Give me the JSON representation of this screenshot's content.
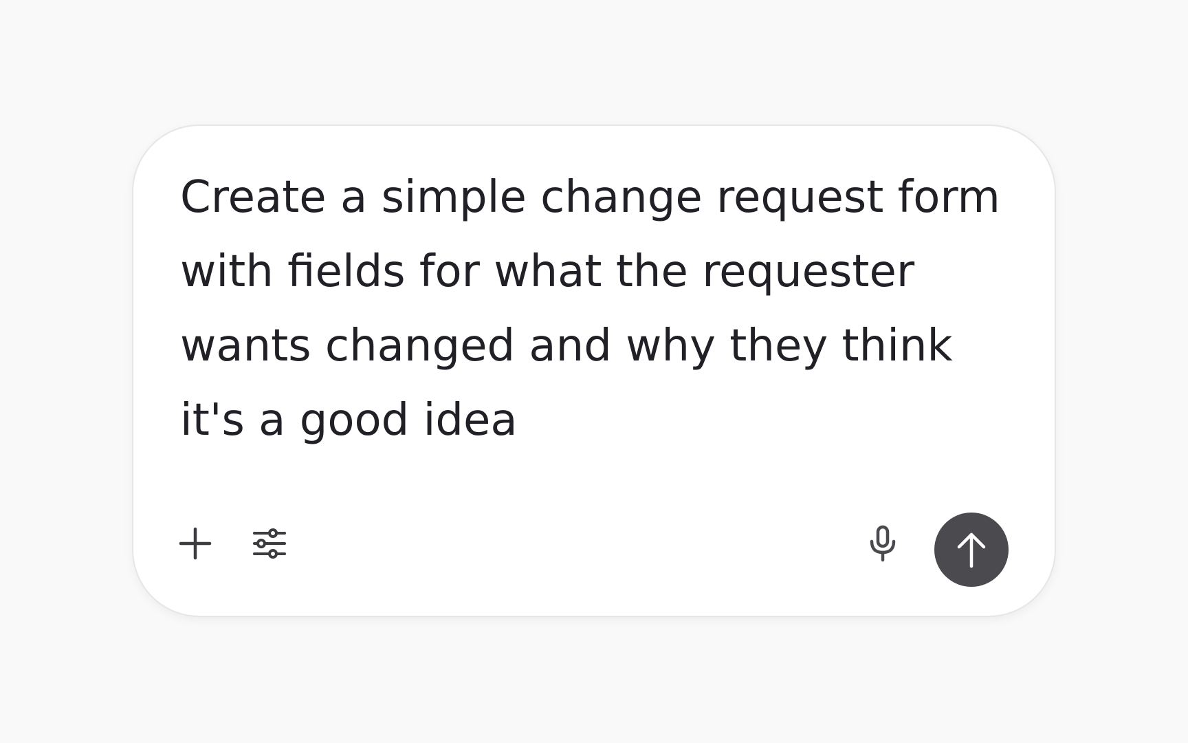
{
  "composer": {
    "prompt_text": "Create a simple change request form with fields for what the requester wants changed and why they think it's a good idea"
  },
  "toolbar": {
    "left_icons": [
      "plus-icon",
      "sliders-icon"
    ],
    "right_icons": [
      "microphone-icon",
      "arrow-up-icon"
    ]
  },
  "colors": {
    "page_background": "#f9f9f9",
    "composer_background": "#ffffff",
    "text": "#202026",
    "send_button": "#4a4a4f"
  }
}
